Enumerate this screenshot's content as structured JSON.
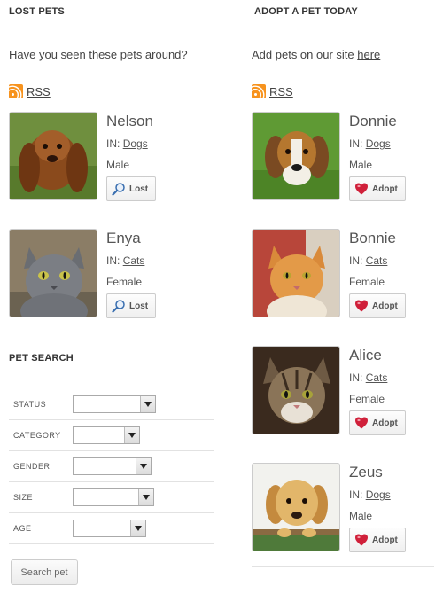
{
  "lost": {
    "title": "LOST PETS",
    "intro": "Have you seen these pets around?",
    "rss_label": "RSS",
    "pets": [
      {
        "name": "Nelson",
        "in_label": "IN:",
        "category": "Dogs",
        "gender": "Male",
        "button": "Lost"
      },
      {
        "name": "Enya",
        "in_label": "IN:",
        "category": "Cats",
        "gender": "Female",
        "button": "Lost"
      }
    ]
  },
  "adopt": {
    "title": "ADOPT A PET TODAY",
    "intro_text": "Add pets on our site",
    "intro_link": "here",
    "rss_label": "RSS",
    "pets": [
      {
        "name": "Donnie",
        "in_label": "IN:",
        "category": "Dogs",
        "gender": "Male",
        "button": "Adopt"
      },
      {
        "name": "Bonnie",
        "in_label": "IN:",
        "category": "Cats",
        "gender": "Female",
        "button": "Adopt"
      },
      {
        "name": "Alice",
        "in_label": "IN:",
        "category": "Cats",
        "gender": "Female",
        "button": "Adopt"
      },
      {
        "name": "Zeus",
        "in_label": "IN:",
        "category": "Dogs",
        "gender": "Male",
        "button": "Adopt"
      }
    ]
  },
  "search": {
    "title": "PET SEARCH",
    "fields": [
      {
        "label": "STATUS",
        "value": ""
      },
      {
        "label": "CATEGORY",
        "value": ""
      },
      {
        "label": "GENDER",
        "value": ""
      },
      {
        "label": "SIZE",
        "value": ""
      },
      {
        "label": "AGE",
        "value": ""
      }
    ],
    "button": "Search pet"
  },
  "colors": {
    "rss": "#f7931e",
    "heart": "#d0203a",
    "magnifier": "#3a6fb0"
  },
  "icons": {
    "rss": "rss-icon",
    "lost": "magnifier-icon",
    "adopt": "heart-icon",
    "select_arrow": "chevron-down-icon"
  }
}
